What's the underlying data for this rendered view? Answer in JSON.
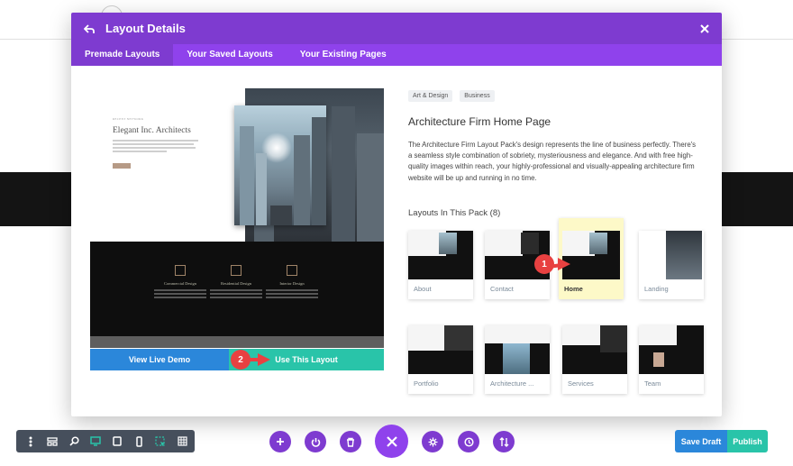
{
  "modal": {
    "title": "Layout Details",
    "tabs": [
      {
        "label": "Premade Layouts",
        "active": true
      },
      {
        "label": "Your Saved Layouts",
        "active": false
      },
      {
        "label": "Your Existing Pages",
        "active": false
      }
    ]
  },
  "preview": {
    "heading": "Elegant Inc. Architects",
    "small_label": "RECENT NETWORK",
    "columns": [
      "Commercial Design",
      "Residential Design",
      "Interior Design"
    ],
    "view_demo_label": "View Live Demo",
    "use_layout_label": "Use This Layout"
  },
  "details": {
    "tags": [
      "Art & Design",
      "Business"
    ],
    "title": "Architecture Firm Home Page",
    "description": "The Architecture Firm Layout Pack's design represents the line of business perfectly. There's a seamless style combination of sobriety, mysteriousness and elegance. And with free high-quality images within reach, your highly-professional and visually-appealing architecture firm website will be up and running in no time.",
    "pack_title": "Layouts In This Pack (8)",
    "layouts": [
      {
        "label": "About",
        "selected": false
      },
      {
        "label": "Contact",
        "selected": false
      },
      {
        "label": "Home",
        "selected": true
      },
      {
        "label": "Landing",
        "selected": false
      },
      {
        "label": "Portfolio",
        "selected": false
      },
      {
        "label": "Architecture ...",
        "selected": false
      },
      {
        "label": "Services",
        "selected": false
      },
      {
        "label": "Team",
        "selected": false
      }
    ]
  },
  "annotations": {
    "badge1": "1",
    "badge2": "2"
  },
  "toolbar": {
    "save_draft_label": "Save Draft",
    "publish_label": "Publish"
  },
  "colors": {
    "purple": "#7e3bd0",
    "purple_light": "#8f42ec",
    "blue": "#2b87da",
    "teal": "#29c4a9",
    "red": "#e84141"
  }
}
